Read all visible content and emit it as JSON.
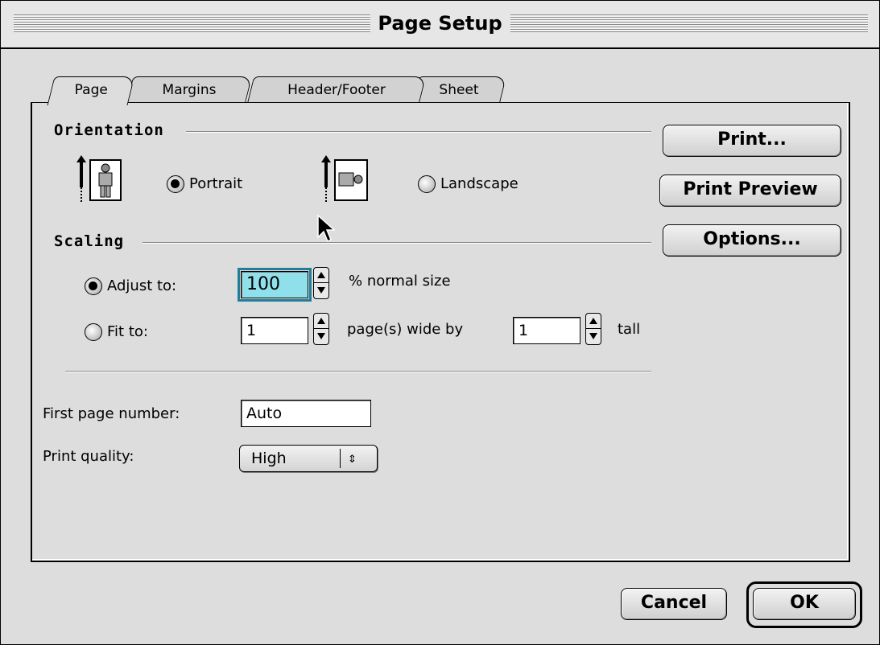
{
  "window": {
    "title": "Page Setup"
  },
  "tabs": [
    {
      "label": "Page",
      "active": true
    },
    {
      "label": "Margins",
      "active": false
    },
    {
      "label": "Header/Footer",
      "active": false
    },
    {
      "label": "Sheet",
      "active": false
    }
  ],
  "orientation": {
    "title": "Orientation",
    "portrait_label": "Portrait",
    "landscape_label": "Landscape",
    "selected": "Portrait",
    "portrait_icon": "portrait-person-icon",
    "landscape_icon": "landscape-person-icon"
  },
  "scaling": {
    "title": "Scaling",
    "adjust_label": "Adjust to:",
    "adjust_value": "100",
    "adjust_suffix": "% normal size",
    "fit_label": "Fit to:",
    "fit_wide_value": "1",
    "fit_wide_suffix": "page(s) wide by",
    "fit_tall_value": "1",
    "fit_tall_suffix": "tall",
    "selected": "Adjust to:"
  },
  "first_page": {
    "label": "First page number:",
    "value": "Auto"
  },
  "print_quality": {
    "label": "Print quality:",
    "value": "High"
  },
  "side_buttons": {
    "print": "Print...",
    "print_preview": "Print Preview",
    "options": "Options..."
  },
  "footer_buttons": {
    "cancel": "Cancel",
    "ok": "OK"
  },
  "colors": {
    "focus_field": "#8fe0ea",
    "focus_ring": "#1f7f9a",
    "dialog_bg": "#dddddd"
  }
}
